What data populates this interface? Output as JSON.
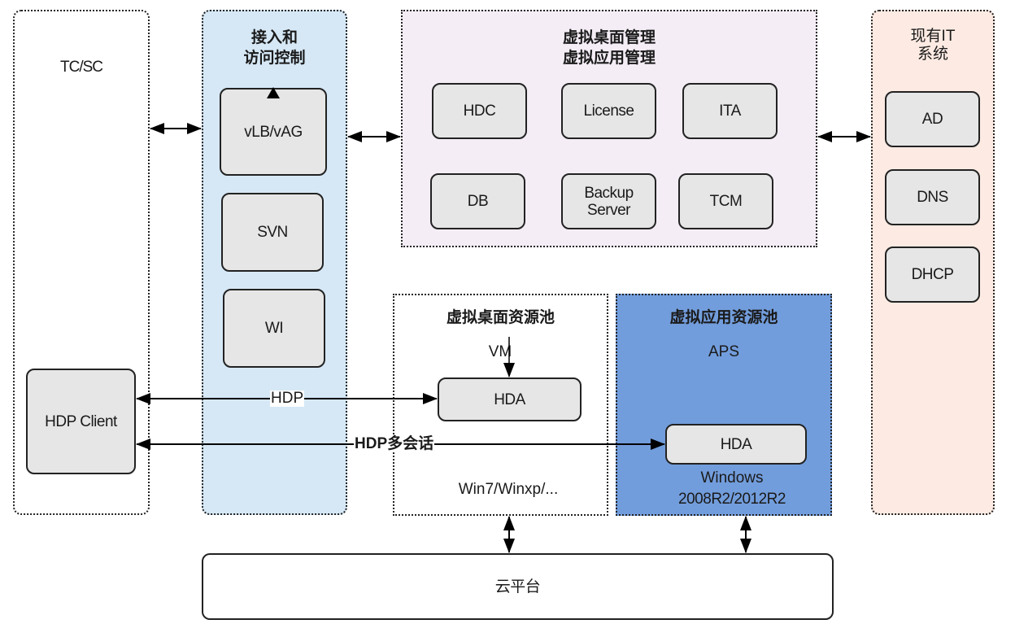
{
  "diagram": {
    "groups": {
      "tc_sc": {
        "title": "TC/SC",
        "client": "HDP Client"
      },
      "access": {
        "title_line1": "接入和",
        "title_line2": "访问控制",
        "color": "#d6e8f6",
        "nodes": [
          "vLB/vAG",
          "SVN",
          "WI"
        ]
      },
      "management": {
        "title_line1": "虚拟桌面管理",
        "title_line2": "虚拟应用管理",
        "color": "#f4edf6",
        "nodes": [
          "HDC",
          "License",
          "ITA",
          "DB",
          "Backup Server",
          "TCM"
        ]
      },
      "it_system": {
        "title_line1": "现有IT",
        "title_line2": "系统",
        "color": "#fdebe3",
        "nodes": [
          "AD",
          "DNS",
          "DHCP"
        ]
      },
      "desktop_pool": {
        "title": "虚拟桌面资源池",
        "vm_label": "VM",
        "node": "HDA",
        "os_label": "Win7/Winxp/..."
      },
      "app_pool": {
        "title": "虚拟应用资源池",
        "color": "#729ddc",
        "aps_label": "APS",
        "node": "HDA",
        "os_line1": "Windows",
        "os_line2": "2008R2/2012R2"
      },
      "cloud": {
        "title": "云平台"
      }
    },
    "edges": {
      "hdp": "HDP",
      "hdp_multi": "HDP多会话"
    }
  }
}
